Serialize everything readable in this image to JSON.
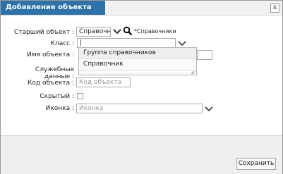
{
  "dialog": {
    "title": "Добавление объекта",
    "close_symbol": "x"
  },
  "fields": {
    "parent": {
      "label": "Старший объект :",
      "value": "Справочни",
      "hint": "*Справочники"
    },
    "class": {
      "label": "Класс :",
      "value": "|"
    },
    "name": {
      "label": "Имя объекта :"
    },
    "service": {
      "label": "Служебные данные :"
    },
    "code": {
      "label": "Код объекта :",
      "placeholder": "Код объекта"
    },
    "hidden": {
      "label": "Скрытый :"
    },
    "icon": {
      "label": "Иконка :",
      "placeholder": "Иконка"
    }
  },
  "class_dropdown": {
    "items": [
      "Группа справочников",
      "Справочник"
    ]
  },
  "footer": {
    "save_label": "Сохранить"
  }
}
